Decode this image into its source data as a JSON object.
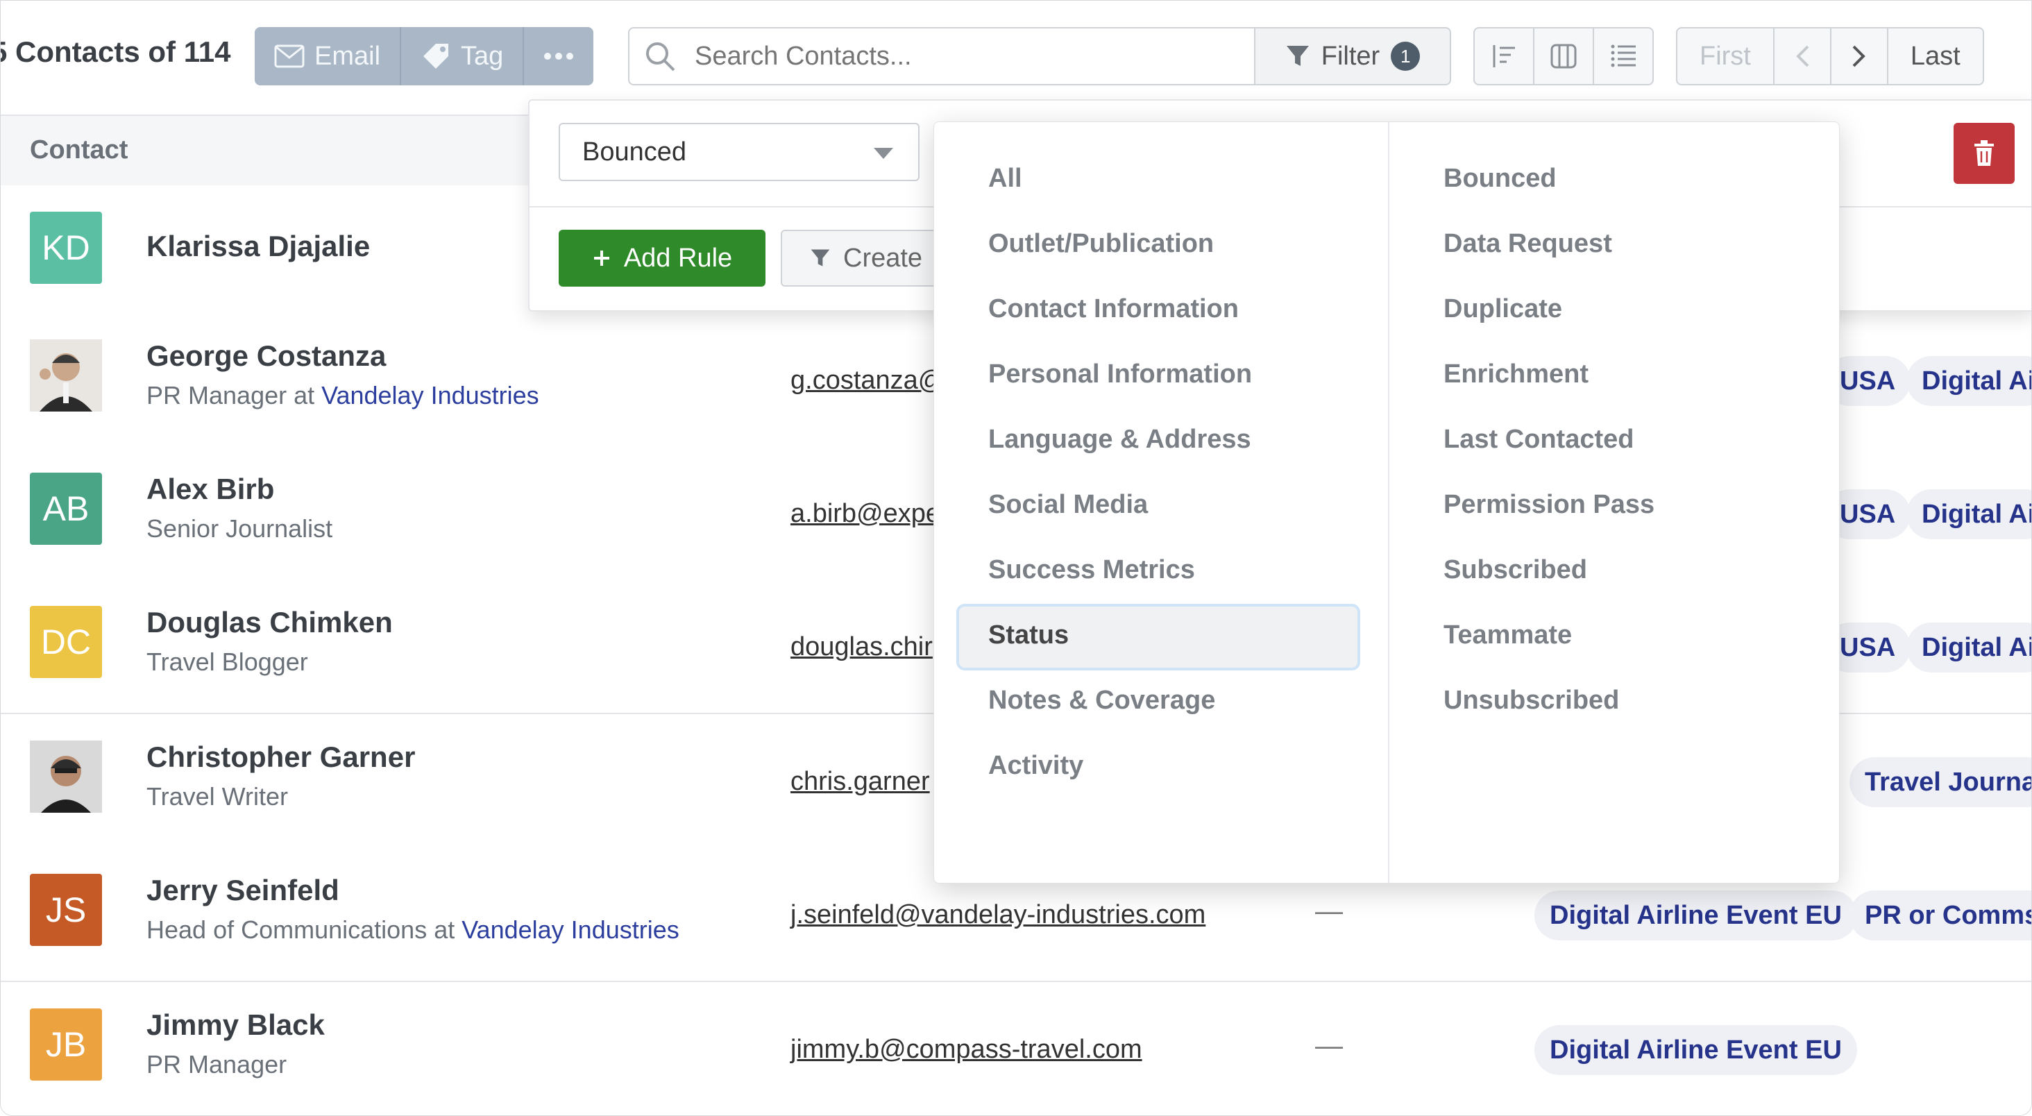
{
  "toolbar": {
    "count_prefix": "5 Contacts",
    "count_suffix": "of 114",
    "email_label": "Email",
    "tag_label": "Tag",
    "search_placeholder": "Search Contacts...",
    "filter_label": "Filter",
    "filter_count": "1",
    "pager": {
      "first": "First",
      "last": "Last"
    }
  },
  "table": {
    "header_contact": "Contact",
    "rows": [
      {
        "initials": "KD",
        "color": "#5bbfa4",
        "name": "Klarissa Djajalie"
      },
      {
        "photo": true,
        "name": "George Costanza",
        "title": "PR Manager at ",
        "company": "Vandelay Industries",
        "email": "g.costanza@",
        "tags": [
          "USA",
          "Digital Ai"
        ]
      },
      {
        "initials": "AB",
        "color": "#4aa587",
        "name": "Alex Birb",
        "title": "Senior Journalist",
        "email": "a.birb@expe",
        "tags": [
          "USA",
          "Digital Ai"
        ]
      },
      {
        "initials": "DC",
        "color": "#ecc544",
        "name": "Douglas Chimken",
        "title": "Travel Blogger",
        "email": "douglas.chir",
        "tags": [
          "USA",
          "Digital Ai"
        ]
      },
      {
        "photo": true,
        "name": "Christopher Garner",
        "title": "Travel Writer",
        "email": "chris.garner",
        "tags": [
          "Travel Journa"
        ]
      },
      {
        "initials": "JS",
        "color": "#c65a26",
        "name": "Jerry Seinfeld",
        "title": "Head of Communications at ",
        "company": "Vandelay Industries",
        "email": "j.seinfeld@vandelay-industries.com",
        "dash": "—",
        "tags": [
          "Digital Airline Event EU",
          "PR or Comms"
        ]
      },
      {
        "initials": "JB",
        "color": "#eda240",
        "name": "Jimmy Black",
        "title": "PR Manager",
        "email": "jimmy.b@compass-travel.com",
        "dash": "—",
        "tags": [
          "Digital Airline Event EU"
        ]
      }
    ]
  },
  "rule": {
    "selected_value": "Bounced",
    "add_rule_label": "Add Rule",
    "create_label": "Create"
  },
  "dropdown": {
    "categories": [
      "All",
      "Outlet/Publication",
      "Contact Information",
      "Personal Information",
      "Language & Address",
      "Social Media",
      "Success Metrics",
      "Status",
      "Notes & Coverage",
      "Activity"
    ],
    "selected_category": "Status",
    "options": [
      "Bounced",
      "Data Request",
      "Duplicate",
      "Enrichment",
      "Last Contacted",
      "Permission Pass",
      "Subscribed",
      "Teammate",
      "Unsubscribed"
    ]
  },
  "colors": {
    "add_rule": "#2f8a2a",
    "delete": "#c0363a",
    "tag_text": "#26338a",
    "company_link": "#2d3f9e"
  }
}
